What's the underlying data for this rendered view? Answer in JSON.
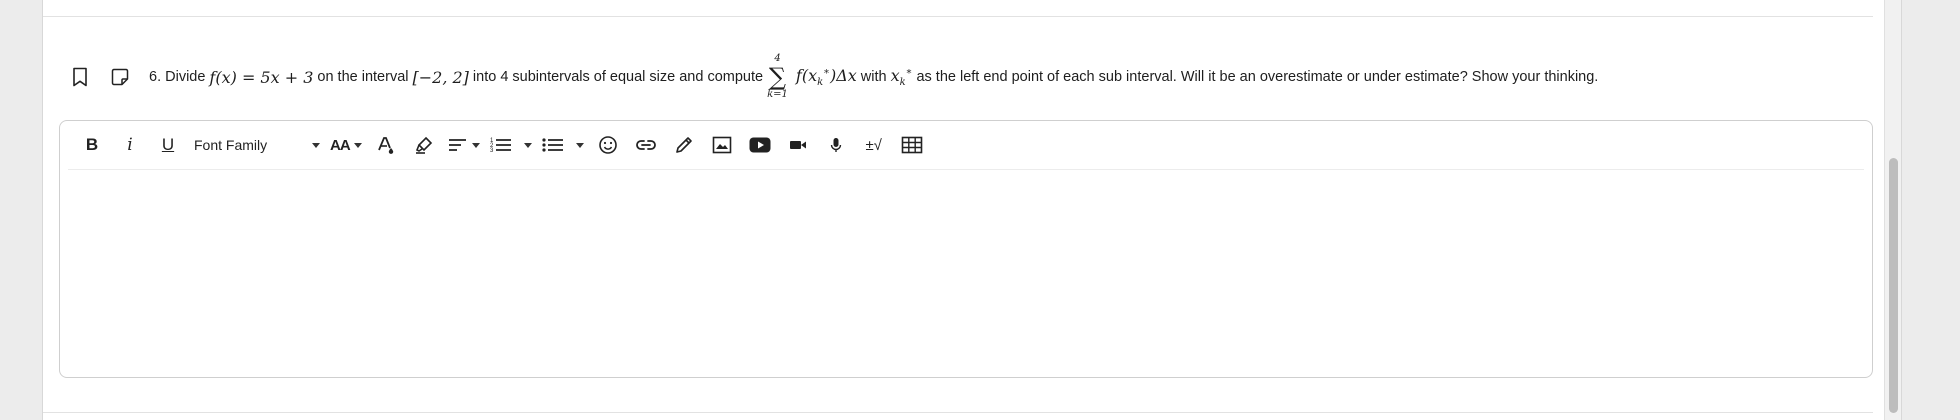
{
  "question": {
    "number": "6.",
    "lead": "Divide",
    "function": "f(x) = 5x + 3",
    "on_text": "on the interval",
    "interval": "[−2, 2]",
    "into_text": "into 4 subintervals of equal size and compute",
    "sum_upper": "4",
    "sum_lower": "k=1",
    "sum_symbol": "∑",
    "summand": "f(x",
    "summand_sub": "k",
    "summand_sup": "∗",
    "summand_end": ")Δx",
    "with_text": "with",
    "xk": "x",
    "xk_sub": "k",
    "xk_sup": "∗",
    "tail_text": "as the left end point of each sub interval. Will it be an overestimate or under estimate? Show your thinking."
  },
  "toolbar": {
    "bold": "B",
    "italic": "i",
    "underline": "U",
    "font_family": "Font Family",
    "font_size": "AA",
    "special_chars": "±√"
  },
  "icons": [
    "bookmark-icon",
    "note-icon",
    "bold-icon",
    "italic-icon",
    "underline-icon",
    "font-size-icon",
    "text-color-icon",
    "highlight-icon",
    "align-icon",
    "ordered-list-icon",
    "unordered-list-icon",
    "emoji-icon",
    "link-icon",
    "draw-icon",
    "image-icon",
    "youtube-icon",
    "video-icon",
    "microphone-icon",
    "math-icon",
    "table-icon"
  ],
  "colors": {
    "youtube": "#222222",
    "border": "#cfcfcf"
  }
}
